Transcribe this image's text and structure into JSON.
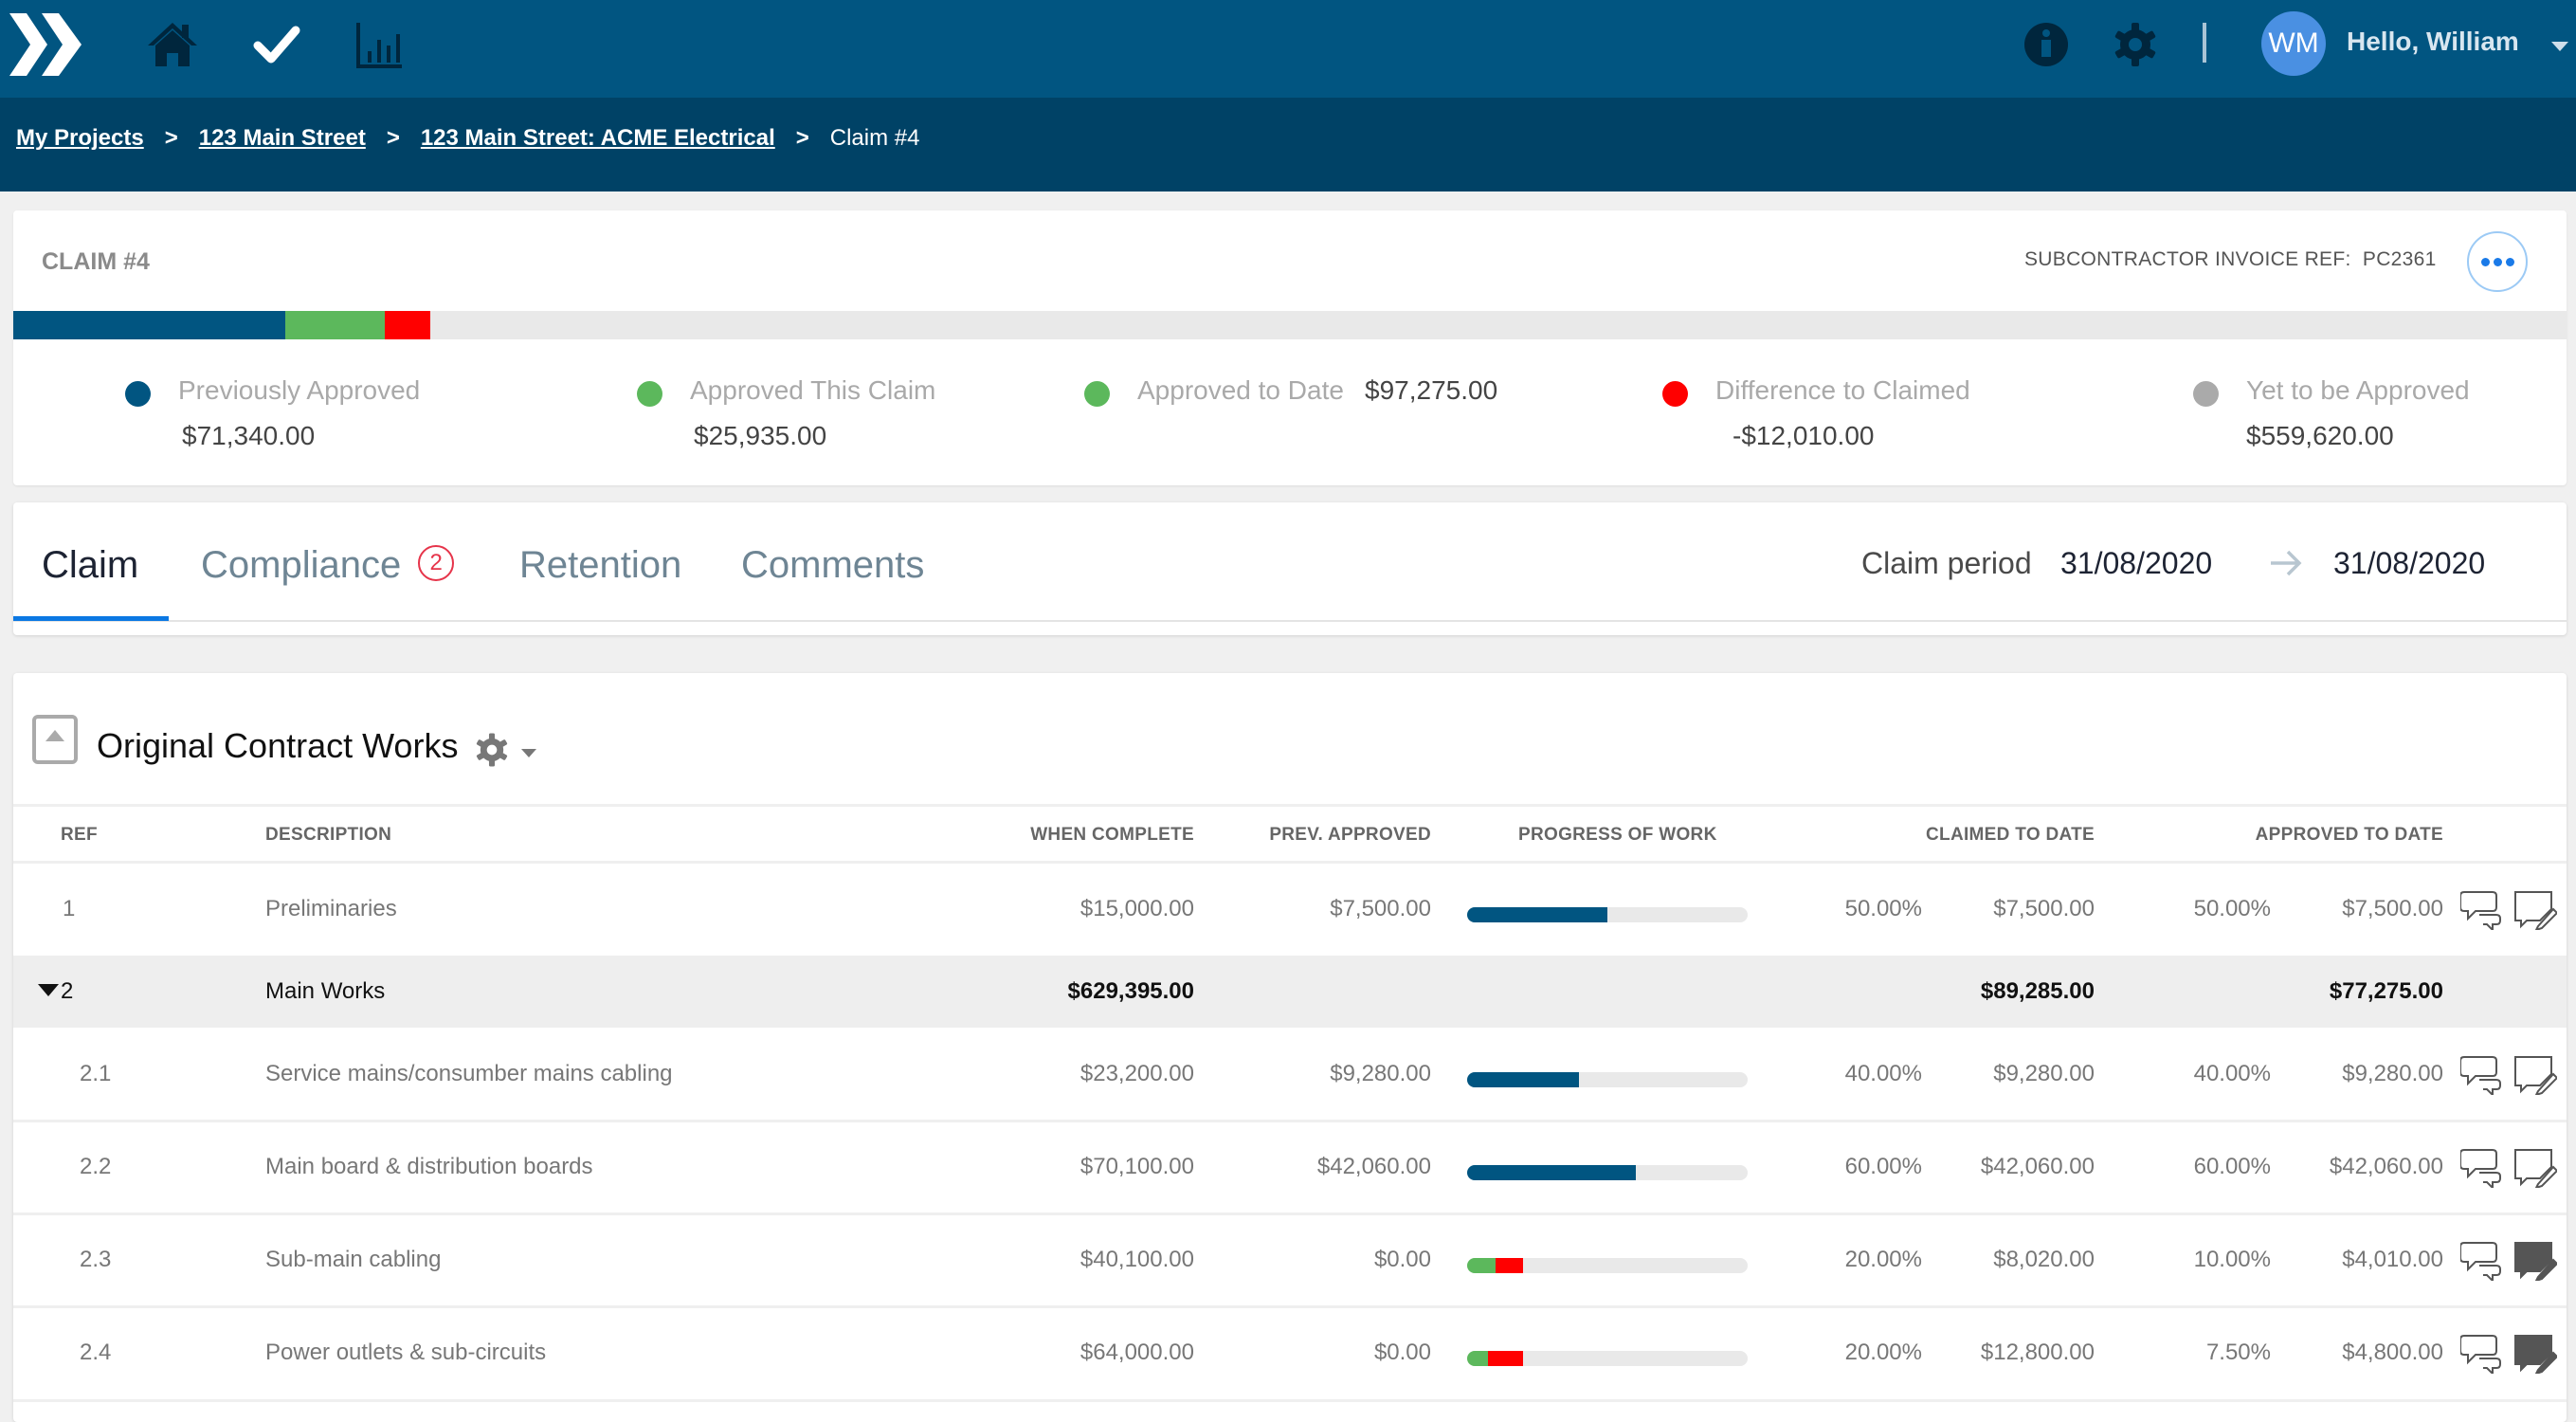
{
  "header": {
    "nav_icons": [
      "home-icon",
      "check-icon",
      "chart-icon"
    ],
    "right_icons": [
      "info-icon",
      "gear-icon"
    ],
    "user_initials": "WM",
    "greeting": "Hello, William"
  },
  "breadcrumb": {
    "items": [
      "My Projects",
      "123 Main Street",
      "123 Main Street: ACME Electrical"
    ],
    "separator": ">",
    "current": "Claim #4"
  },
  "claim": {
    "title": "CLAIM #4",
    "invoice_ref_label": "SUBCONTRACTOR INVOICE REF:",
    "invoice_ref": "PC2361",
    "stack_bar": {
      "total": 668895.0,
      "segments": [
        {
          "name": "Previously Approved",
          "value": 71340.0,
          "color": "#015581"
        },
        {
          "name": "Approved This Claim",
          "value": 25935.0,
          "color": "#5cb85c"
        },
        {
          "name": "Difference to Claimed",
          "value": 12010.0,
          "color": "#ff0000"
        }
      ]
    },
    "legend": [
      {
        "label": "Previously Approved",
        "value": "$71,340.00",
        "color": "#015581"
      },
      {
        "label": "Approved This Claim",
        "value": "$25,935.00",
        "color": "#5cb85c"
      },
      {
        "label": "Approved to Date",
        "value": "$97,275.00",
        "color": "#5cb85c"
      },
      {
        "label": "Difference to Claimed",
        "value": "-$12,010.00",
        "color": "#ff0000"
      },
      {
        "label": "Yet to be Approved",
        "value": "$559,620.00",
        "color": "#aaaaaa"
      }
    ]
  },
  "tabs": {
    "items": [
      {
        "label": "Claim",
        "active": true
      },
      {
        "label": "Compliance",
        "badge": "2"
      },
      {
        "label": "Retention"
      },
      {
        "label": "Comments"
      }
    ],
    "period_label": "Claim period",
    "period_start": "31/08/2020",
    "period_end": "31/08/2020"
  },
  "section": {
    "title": "Original Contract Works",
    "columns": [
      "REF",
      "DESCRIPTION",
      "WHEN COMPLETE",
      "PREV. APPROVED",
      "PROGRESS OF WORK",
      "CLAIMED TO DATE",
      "APPROVED TO DATE"
    ],
    "rows": [
      {
        "ref": "1",
        "description": "Preliminaries",
        "when_complete": "$15,000.00",
        "prev_approved": "$7,500.00",
        "progress": [
          {
            "pct": 50,
            "color": "#015581"
          }
        ],
        "claimed_pct": "50.00%",
        "claimed": "$7,500.00",
        "approved_pct": "50.00%",
        "approved": "$7,500.00",
        "note_filled": false
      },
      {
        "ref": "2",
        "description": "Main Works",
        "when_complete": "$629,395.00",
        "claimed": "$89,285.00",
        "approved": "$77,275.00",
        "group": true
      },
      {
        "ref": "2.1",
        "description": "Service mains/consumber mains cabling",
        "when_complete": "$23,200.00",
        "prev_approved": "$9,280.00",
        "progress": [
          {
            "pct": 40,
            "color": "#015581"
          }
        ],
        "claimed_pct": "40.00%",
        "claimed": "$9,280.00",
        "approved_pct": "40.00%",
        "approved": "$9,280.00",
        "note_filled": false
      },
      {
        "ref": "2.2",
        "description": "Main board & distribution boards",
        "when_complete": "$70,100.00",
        "prev_approved": "$42,060.00",
        "progress": [
          {
            "pct": 60,
            "color": "#015581"
          }
        ],
        "claimed_pct": "60.00%",
        "claimed": "$42,060.00",
        "approved_pct": "60.00%",
        "approved": "$42,060.00",
        "note_filled": false
      },
      {
        "ref": "2.3",
        "description": "Sub-main cabling",
        "when_complete": "$40,100.00",
        "prev_approved": "$0.00",
        "progress": [
          {
            "pct": 10,
            "color": "#5cb85c"
          },
          {
            "pct": 10,
            "color": "#ff0000"
          }
        ],
        "claimed_pct": "20.00%",
        "claimed": "$8,020.00",
        "approved_pct": "10.00%",
        "approved": "$4,010.00",
        "note_filled": true
      },
      {
        "ref": "2.4",
        "description": "Power outlets & sub-circuits",
        "when_complete": "$64,000.00",
        "prev_approved": "$0.00",
        "progress": [
          {
            "pct": 7.5,
            "color": "#5cb85c"
          },
          {
            "pct": 12.5,
            "color": "#ff0000"
          }
        ],
        "claimed_pct": "20.00%",
        "claimed": "$12,800.00",
        "approved_pct": "7.50%",
        "approved": "$4,800.00",
        "note_filled": true
      }
    ]
  }
}
